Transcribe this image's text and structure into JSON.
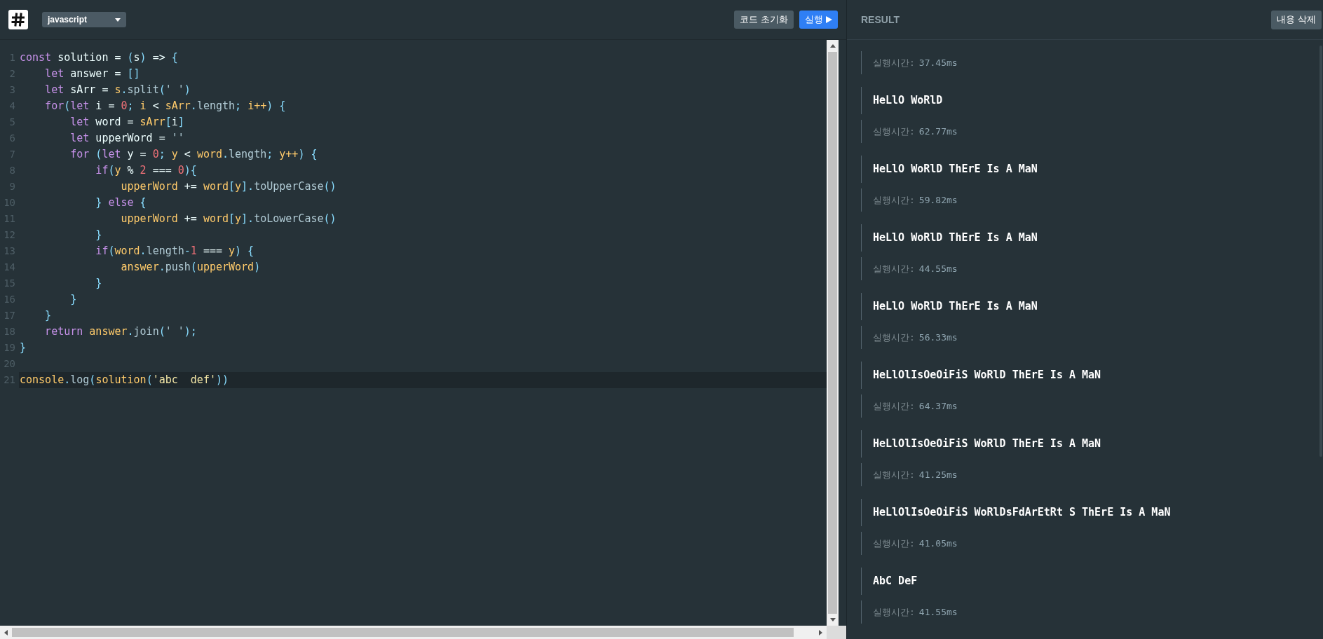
{
  "header": {
    "language": "javascript",
    "buttons": [
      {
        "kind": "secondary",
        "label": "코드 초기화"
      },
      {
        "kind": "primary",
        "label": "실행"
      }
    ]
  },
  "editor": {
    "lines": [
      {
        "number": "1",
        "active": false,
        "tokens": [
          {
            "kind": "kw",
            "text": "const"
          },
          {
            "kind": "id",
            "text": " solution = "
          },
          {
            "kind": "pun",
            "text": "("
          },
          {
            "kind": "id",
            "text": "s"
          },
          {
            "kind": "pun",
            "text": ")"
          },
          {
            "kind": "id",
            "text": " => "
          },
          {
            "kind": "pun",
            "text": "{"
          }
        ]
      },
      {
        "number": "2",
        "active": false,
        "tokens": [
          {
            "kind": "kw",
            "text": "    let"
          },
          {
            "kind": "id",
            "text": " answer = "
          },
          {
            "kind": "pun",
            "text": "[]"
          }
        ]
      },
      {
        "number": "3",
        "active": false,
        "tokens": [
          {
            "kind": "kw",
            "text": "    let"
          },
          {
            "kind": "id",
            "text": " sArr = "
          },
          {
            "kind": "var",
            "text": "s"
          },
          {
            "kind": "pun",
            "text": "."
          },
          {
            "kind": "prop",
            "text": "split"
          },
          {
            "kind": "pun",
            "text": "("
          },
          {
            "kind": "prop",
            "text": "' '"
          },
          {
            "kind": "pun",
            "text": ")"
          }
        ]
      },
      {
        "number": "4",
        "active": false,
        "tokens": [
          {
            "kind": "kw",
            "text": "    for"
          },
          {
            "kind": "pun",
            "text": "("
          },
          {
            "kind": "kw",
            "text": "let"
          },
          {
            "kind": "id",
            "text": " i = "
          },
          {
            "kind": "num",
            "text": "0"
          },
          {
            "kind": "pun",
            "text": "; "
          },
          {
            "kind": "var",
            "text": "i"
          },
          {
            "kind": "id",
            "text": " < "
          },
          {
            "kind": "var",
            "text": "sArr"
          },
          {
            "kind": "pun",
            "text": "."
          },
          {
            "kind": "prop",
            "text": "length"
          },
          {
            "kind": "pun",
            "text": "; "
          },
          {
            "kind": "var",
            "text": "i++"
          },
          {
            "kind": "pun",
            "text": ") {"
          }
        ]
      },
      {
        "number": "5",
        "active": false,
        "tokens": [
          {
            "kind": "kw",
            "text": "        let"
          },
          {
            "kind": "id",
            "text": " word = "
          },
          {
            "kind": "var",
            "text": "sArr"
          },
          {
            "kind": "pun",
            "text": "["
          },
          {
            "kind": "id",
            "text": "i"
          },
          {
            "kind": "pun",
            "text": "]"
          }
        ]
      },
      {
        "number": "6",
        "active": false,
        "tokens": [
          {
            "kind": "kw",
            "text": "        let"
          },
          {
            "kind": "id",
            "text": " upperWord = "
          },
          {
            "kind": "prop",
            "text": "''"
          }
        ]
      },
      {
        "number": "7",
        "active": false,
        "tokens": [
          {
            "kind": "kw",
            "text": "        for"
          },
          {
            "kind": "pun",
            "text": " ("
          },
          {
            "kind": "kw",
            "text": "let"
          },
          {
            "kind": "id",
            "text": " y = "
          },
          {
            "kind": "num",
            "text": "0"
          },
          {
            "kind": "pun",
            "text": "; "
          },
          {
            "kind": "var",
            "text": "y"
          },
          {
            "kind": "id",
            "text": " < "
          },
          {
            "kind": "var",
            "text": "word"
          },
          {
            "kind": "pun",
            "text": "."
          },
          {
            "kind": "prop",
            "text": "length"
          },
          {
            "kind": "pun",
            "text": "; "
          },
          {
            "kind": "var",
            "text": "y++"
          },
          {
            "kind": "pun",
            "text": ") {"
          }
        ]
      },
      {
        "number": "8",
        "active": false,
        "tokens": [
          {
            "kind": "kw",
            "text": "            if"
          },
          {
            "kind": "pun",
            "text": "("
          },
          {
            "kind": "var",
            "text": "y"
          },
          {
            "kind": "id",
            "text": " % "
          },
          {
            "kind": "num",
            "text": "2"
          },
          {
            "kind": "id",
            "text": " === "
          },
          {
            "kind": "num",
            "text": "0"
          },
          {
            "kind": "pun",
            "text": "){"
          }
        ]
      },
      {
        "number": "9",
        "active": false,
        "tokens": [
          {
            "kind": "var",
            "text": "                upperWord"
          },
          {
            "kind": "id",
            "text": " += "
          },
          {
            "kind": "var",
            "text": "word"
          },
          {
            "kind": "pun",
            "text": "["
          },
          {
            "kind": "var",
            "text": "y"
          },
          {
            "kind": "pun",
            "text": "]."
          },
          {
            "kind": "prop",
            "text": "toUpperCase"
          },
          {
            "kind": "pun",
            "text": "()"
          }
        ]
      },
      {
        "number": "10",
        "active": false,
        "tokens": [
          {
            "kind": "pun",
            "text": "            } "
          },
          {
            "kind": "kw",
            "text": "else"
          },
          {
            "kind": "pun",
            "text": " {"
          }
        ]
      },
      {
        "number": "11",
        "active": false,
        "tokens": [
          {
            "kind": "var",
            "text": "                upperWord"
          },
          {
            "kind": "id",
            "text": " += "
          },
          {
            "kind": "var",
            "text": "word"
          },
          {
            "kind": "pun",
            "text": "["
          },
          {
            "kind": "var",
            "text": "y"
          },
          {
            "kind": "pun",
            "text": "]."
          },
          {
            "kind": "prop",
            "text": "toLowerCase"
          },
          {
            "kind": "pun",
            "text": "()"
          }
        ]
      },
      {
        "number": "12",
        "active": false,
        "tokens": [
          {
            "kind": "pun",
            "text": "            }"
          }
        ]
      },
      {
        "number": "13",
        "active": false,
        "tokens": [
          {
            "kind": "kw",
            "text": "            if"
          },
          {
            "kind": "pun",
            "text": "("
          },
          {
            "kind": "var",
            "text": "word"
          },
          {
            "kind": "pun",
            "text": "."
          },
          {
            "kind": "prop",
            "text": "length"
          },
          {
            "kind": "pun",
            "text": "-"
          },
          {
            "kind": "num",
            "text": "1"
          },
          {
            "kind": "id",
            "text": " === "
          },
          {
            "kind": "var",
            "text": "y"
          },
          {
            "kind": "pun",
            "text": ") {"
          }
        ]
      },
      {
        "number": "14",
        "active": false,
        "tokens": [
          {
            "kind": "var",
            "text": "                answer"
          },
          {
            "kind": "pun",
            "text": "."
          },
          {
            "kind": "prop",
            "text": "push"
          },
          {
            "kind": "pun",
            "text": "("
          },
          {
            "kind": "var",
            "text": "upperWord"
          },
          {
            "kind": "pun",
            "text": ")"
          }
        ]
      },
      {
        "number": "15",
        "active": false,
        "tokens": [
          {
            "kind": "pun",
            "text": "            }"
          }
        ]
      },
      {
        "number": "16",
        "active": false,
        "tokens": [
          {
            "kind": "pun",
            "text": "        }"
          }
        ]
      },
      {
        "number": "17",
        "active": false,
        "tokens": [
          {
            "kind": "pun",
            "text": "    }"
          }
        ]
      },
      {
        "number": "18",
        "active": false,
        "tokens": [
          {
            "kind": "kw",
            "text": "    return"
          },
          {
            "kind": "var",
            "text": " answer"
          },
          {
            "kind": "pun",
            "text": "."
          },
          {
            "kind": "prop",
            "text": "join"
          },
          {
            "kind": "pun",
            "text": "("
          },
          {
            "kind": "prop",
            "text": "' '"
          },
          {
            "kind": "pun",
            "text": ");"
          }
        ]
      },
      {
        "number": "19",
        "active": false,
        "tokens": [
          {
            "kind": "pun",
            "text": "}"
          }
        ]
      },
      {
        "number": "20",
        "active": false
      },
      {
        "number": "21",
        "active": true,
        "tokens": [
          {
            "kind": "var",
            "text": "console"
          },
          {
            "kind": "pun",
            "text": "."
          },
          {
            "kind": "prop",
            "text": "log"
          },
          {
            "kind": "pun",
            "text": "("
          },
          {
            "kind": "var",
            "text": "solution"
          },
          {
            "kind": "pun",
            "text": "("
          },
          {
            "kind": "str",
            "text": "'abc  def'"
          },
          {
            "kind": "pun",
            "text": "))"
          }
        ]
      }
    ]
  },
  "result": {
    "title": "RESULT",
    "clear_button": "내용 삭제",
    "entries": [
      {
        "time_label": "실행시간:",
        "time": "37.45ms"
      },
      {
        "output": "HeLlO WoRlD",
        "time_label": "실행시간:",
        "time": "62.77ms"
      },
      {
        "output": "HeLlO WoRlD ThErE Is A MaN",
        "time_label": "실행시간:",
        "time": "59.82ms"
      },
      {
        "output": "HeLlO WoRlD ThErE Is A MaN",
        "time_label": "실행시간:",
        "time": "44.55ms"
      },
      {
        "output": "HeLlO WoRlD ThErE Is A MaN",
        "time_label": "실행시간:",
        "time": "56.33ms"
      },
      {
        "output": "HeLlOlIsOeOiFiS WoRlD ThErE Is A MaN",
        "time_label": "실행시간:",
        "time": "64.37ms"
      },
      {
        "output": "HeLlOlIsOeOiFiS WoRlD ThErE Is A MaN",
        "time_label": "실행시간:",
        "time": "41.25ms"
      },
      {
        "output": "HeLlOlIsOeOiFiS WoRlDsFdArEtRt S ThErE Is A MaN",
        "time_label": "실행시간:",
        "time": "41.05ms"
      },
      {
        "output": "AbC DeF",
        "time_label": "실행시간:",
        "time": "41.55ms"
      }
    ]
  }
}
